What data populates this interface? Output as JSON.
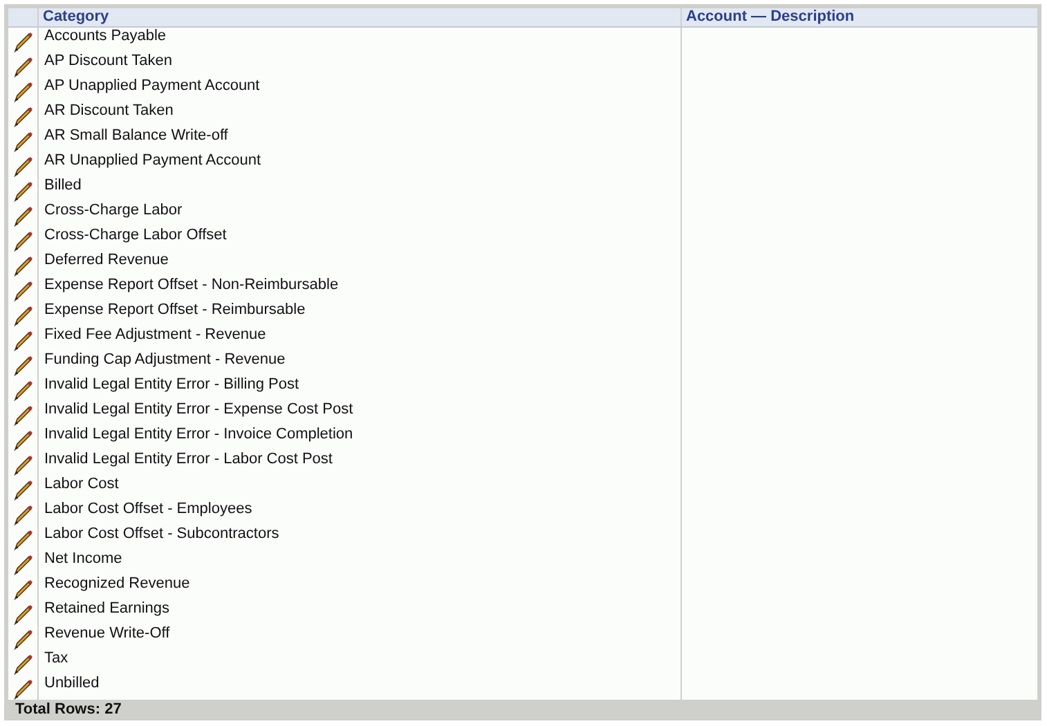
{
  "table": {
    "columns": [
      "Category",
      "Account — Description"
    ],
    "rows": [
      {
        "category": "Accounts Payable"
      },
      {
        "category": "AP Discount Taken"
      },
      {
        "category": "AP Unapplied Payment Account"
      },
      {
        "category": "AR Discount Taken"
      },
      {
        "category": "AR Small Balance Write-off"
      },
      {
        "category": "AR Unapplied Payment Account"
      },
      {
        "category": "Billed"
      },
      {
        "category": "Cross-Charge Labor"
      },
      {
        "category": "Cross-Charge Labor Offset"
      },
      {
        "category": "Deferred Revenue"
      },
      {
        "category": "Expense Report Offset - Non-Reimbursable"
      },
      {
        "category": "Expense Report Offset - Reimbursable"
      },
      {
        "category": "Fixed Fee Adjustment - Revenue"
      },
      {
        "category": "Funding Cap Adjustment - Revenue"
      },
      {
        "category": "Invalid Legal Entity Error - Billing Post"
      },
      {
        "category": "Invalid Legal Entity Error - Expense Cost Post"
      },
      {
        "category": "Invalid Legal Entity Error - Invoice Completion"
      },
      {
        "category": "Invalid Legal Entity Error - Labor Cost Post"
      },
      {
        "category": "Labor Cost"
      },
      {
        "category": "Labor Cost Offset - Employees"
      },
      {
        "category": "Labor Cost Offset - Subcontractors"
      },
      {
        "category": "Net Income"
      },
      {
        "category": "Recognized Revenue"
      },
      {
        "category": "Retained Earnings"
      },
      {
        "category": "Revenue Write-Off"
      },
      {
        "category": "Tax"
      },
      {
        "category": "Unbilled"
      }
    ]
  },
  "footer": "Total Rows: 27"
}
